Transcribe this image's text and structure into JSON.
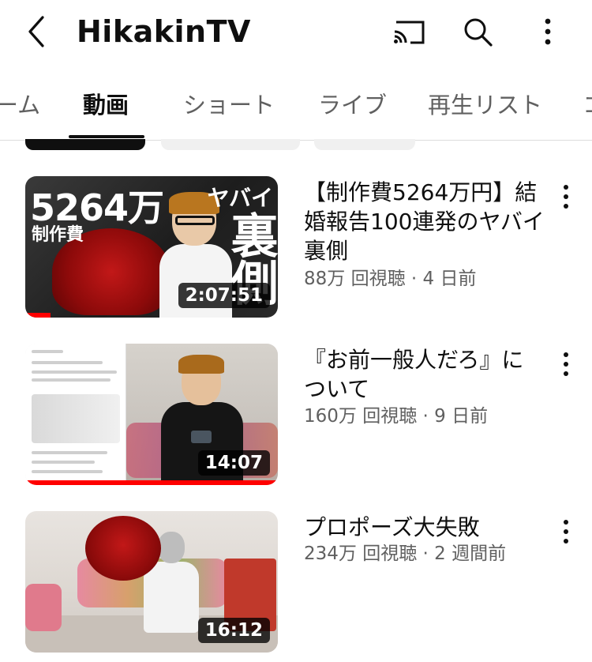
{
  "header": {
    "channel_title": "HikakinTV"
  },
  "tabs": [
    {
      "label": "ーム",
      "active": false
    },
    {
      "label": "動画",
      "active": true
    },
    {
      "label": "ショート",
      "active": false
    },
    {
      "label": "ライブ",
      "active": false
    },
    {
      "label": "再生リスト",
      "active": false
    },
    {
      "label": "コ",
      "active": false
    }
  ],
  "videos": [
    {
      "title": "【制作費5264万円】結婚報告100連発のヤバイ裏側",
      "views": "88万 回視聴",
      "age": "4 日前",
      "duration": "2:07:51",
      "watched_fraction": 0.1,
      "thumb_text": {
        "big": "5264万",
        "sub": "制作費",
        "yabai": "ヤバイ",
        "ura": "裏側"
      }
    },
    {
      "title": "『お前一般人だろ』について",
      "views": "160万 回視聴",
      "age": "9 日前",
      "duration": "14:07",
      "watched_fraction": 1.0
    },
    {
      "title": "プロポーズ大失敗",
      "views": "234万 回視聴",
      "age": "2 週間前",
      "duration": "16:12",
      "watched_fraction": 0
    }
  ],
  "meta_separator": " · "
}
